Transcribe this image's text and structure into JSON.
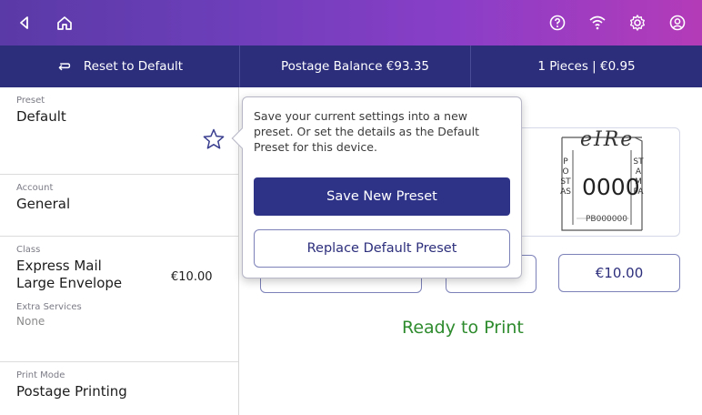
{
  "topbar": {
    "left_icons": [
      "back-icon",
      "home-icon"
    ],
    "right_icons": [
      "help-icon",
      "wifi-icon",
      "settings-icon",
      "account-icon"
    ]
  },
  "subbar": {
    "reset_label": "Reset to Default",
    "postage_balance": "Postage Balance €93.35",
    "pieces": "1 Pieces | €0.95"
  },
  "sidebar": {
    "preset": {
      "label": "Preset",
      "value": "Default"
    },
    "account": {
      "label": "Account",
      "value": "General"
    },
    "class": {
      "label": "Class",
      "value_line1": "Express Mail",
      "value_line2": "Large Envelope",
      "price": "€10.00"
    },
    "extra_services": {
      "label": "Extra Services",
      "value": "None"
    },
    "print_mode": {
      "label": "Print Mode",
      "value": "Postage Printing"
    }
  },
  "stamp": {
    "country": "eIRe",
    "left_side": "POSTAS",
    "right_side": "STAMPA",
    "amount": "0000",
    "meter_id": "PB000000"
  },
  "main": {
    "amount_chip": "€10.00",
    "status": "Ready to Print"
  },
  "popover": {
    "message": "Save your current settings into a new preset. Or set the details as the Default Preset for this device.",
    "save_button": "Save New Preset",
    "replace_button": "Replace Default Preset"
  },
  "colors": {
    "topbar_gradient": [
      "#5a3aa6",
      "#b43bb8"
    ],
    "subbar": "#2c2e7c",
    "primary_button": "#2f3388",
    "status_green": "#2e8b2e"
  }
}
